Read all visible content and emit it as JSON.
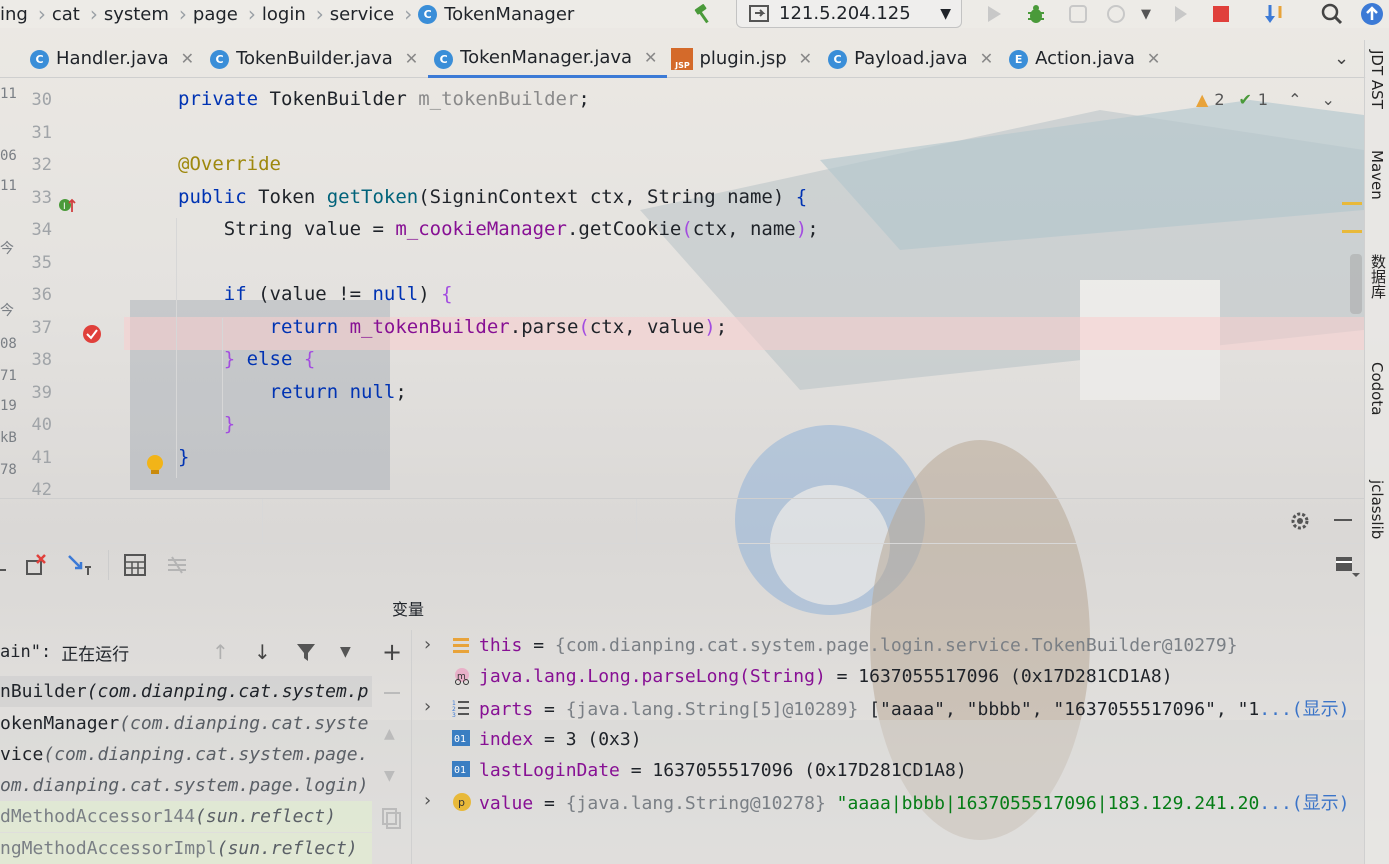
{
  "breadcrumbs": [
    "ing",
    "cat",
    "system",
    "page",
    "login",
    "service",
    "TokenManager"
  ],
  "run_config": "121.5.204.125",
  "tabs": [
    {
      "label": "Handler.java",
      "icon": "C"
    },
    {
      "label": "TokenBuilder.java",
      "icon": "C"
    },
    {
      "label": "TokenManager.java",
      "icon": "C",
      "active": true
    },
    {
      "label": "plugin.jsp",
      "icon": "JSP"
    },
    {
      "label": "Payload.java",
      "icon": "C"
    },
    {
      "label": "Action.java",
      "icon": "E"
    }
  ],
  "inspections": {
    "warnings": "2",
    "ok": "1"
  },
  "left_cut_numbers": [
    "11",
    "06",
    "11",
    "今",
    "今",
    "08",
    "71",
    "19",
    "kB",
    "78"
  ],
  "editor": {
    "lines": [
      {
        "num": "30",
        "tokens": [
          [
            "kw",
            "private "
          ],
          [
            "",
            "TokenBuilder "
          ],
          [
            "gry",
            "m_tokenBuilder"
          ],
          [
            "",
            ";"
          ]
        ]
      },
      {
        "num": "31",
        "tokens": []
      },
      {
        "num": "32",
        "tokens": [
          [
            "an",
            "@Override"
          ]
        ]
      },
      {
        "num": "33",
        "tokens": [
          [
            "kw",
            "public "
          ],
          [
            "",
            "Token "
          ],
          [
            "fn",
            "getToken"
          ],
          [
            "",
            "(SigninContext ctx, String name) "
          ],
          [
            "kw",
            "{"
          ]
        ]
      },
      {
        "num": "34",
        "tokens": [
          [
            "",
            "    String value = "
          ],
          [
            "fld",
            "m_cookieManager"
          ],
          [
            "",
            ".getCookie"
          ],
          [
            "par",
            "("
          ],
          [
            "",
            "ctx, name"
          ],
          [
            "par",
            ")"
          ],
          [
            "",
            ";"
          ]
        ]
      },
      {
        "num": "35",
        "tokens": []
      },
      {
        "num": "36",
        "tokens": [
          [
            "",
            "    "
          ],
          [
            "kw",
            "if "
          ],
          [
            "",
            "(value != "
          ],
          [
            "kw",
            "null"
          ],
          [
            "",
            ") "
          ],
          [
            "par",
            "{"
          ]
        ]
      },
      {
        "num": "37",
        "tokens": [
          [
            "",
            "        "
          ],
          [
            "kw",
            "return "
          ],
          [
            "fld",
            "m_tokenBuilder"
          ],
          [
            "",
            ".parse"
          ],
          [
            "par",
            "("
          ],
          [
            "",
            "ctx, value"
          ],
          [
            "par",
            ")"
          ],
          [
            "",
            ";"
          ]
        ]
      },
      {
        "num": "38",
        "tokens": [
          [
            "",
            "    "
          ],
          [
            "par",
            "} "
          ],
          [
            "kw",
            "else "
          ],
          [
            "par",
            "{"
          ]
        ]
      },
      {
        "num": "39",
        "tokens": [
          [
            "",
            "        "
          ],
          [
            "kw",
            "return "
          ],
          [
            "kw",
            "null"
          ],
          [
            "",
            ";"
          ]
        ]
      },
      {
        "num": "40",
        "tokens": [
          [
            "",
            "    "
          ],
          [
            "par",
            "}"
          ]
        ]
      },
      {
        "num": "41",
        "tokens": [
          [
            "kw",
            "}"
          ]
        ]
      },
      {
        "num": "42",
        "tokens": []
      }
    ]
  },
  "right_strip": [
    "JDT AST",
    "Maven",
    "数据库",
    "Codota",
    "jclasslib"
  ],
  "debugger": {
    "variables_title": "变量",
    "thread_label": "ain\":",
    "thread_status": "正在运行",
    "frames": [
      {
        "name": "nBuilder ",
        "pkg": "(com.dianping.cat.system.p",
        "selected": true
      },
      {
        "name": "okenManager ",
        "pkg": "(com.dianping.cat.syste"
      },
      {
        "name": "vice ",
        "pkg": "(com.dianping.cat.system.page."
      },
      {
        "name": "",
        "pkg": "om.dianping.cat.system.page.login)"
      },
      {
        "name": "dMethodAccessor144 ",
        "pkg": "(sun.reflect)"
      },
      {
        "name": "ngMethodAccessorImpl ",
        "pkg": "(sun.reflect)"
      }
    ],
    "variables": [
      {
        "icon": "field",
        "expand": true,
        "name": "this",
        "eq": " = ",
        "type": "{com.dianping.cat.system.page.login.service.TokenBuilder@10279}",
        "value": "",
        "more": ""
      },
      {
        "icon": "watch",
        "expand": false,
        "name": "java.lang.Long.parseLong(String)",
        "eq": " = ",
        "type": "",
        "value": "1637055517096 (0x17D281CD1A8)",
        "more": ""
      },
      {
        "icon": "array",
        "expand": true,
        "name": "parts",
        "eq": " = ",
        "type": "{java.lang.String[5]@10289} ",
        "value": "[\"aaaa\", \"bbbb\", \"1637055517096\", \"1",
        "more": "...(显示)"
      },
      {
        "icon": "int",
        "expand": false,
        "name": "index",
        "eq": " = ",
        "type": "",
        "value": "3 (0x3)",
        "more": ""
      },
      {
        "icon": "int",
        "expand": false,
        "name": "lastLoginDate",
        "eq": " = ",
        "type": "",
        "value": "1637055517096 (0x17D281CD1A8)",
        "more": ""
      },
      {
        "icon": "param",
        "expand": true,
        "name": "value",
        "eq": " = ",
        "type": "{java.lang.String@10278} ",
        "value": "\"aaaa|bbbb|1637055517096|183.129.241.20",
        "more": "...(显示)",
        "string": true
      }
    ]
  },
  "colors": {
    "keyword": "#0033b3",
    "method": "#00627a",
    "field": "#871094",
    "annotation": "#9e880d",
    "string": "#067d17",
    "accent": "#3c7ad6",
    "stop": "#e0403b"
  }
}
